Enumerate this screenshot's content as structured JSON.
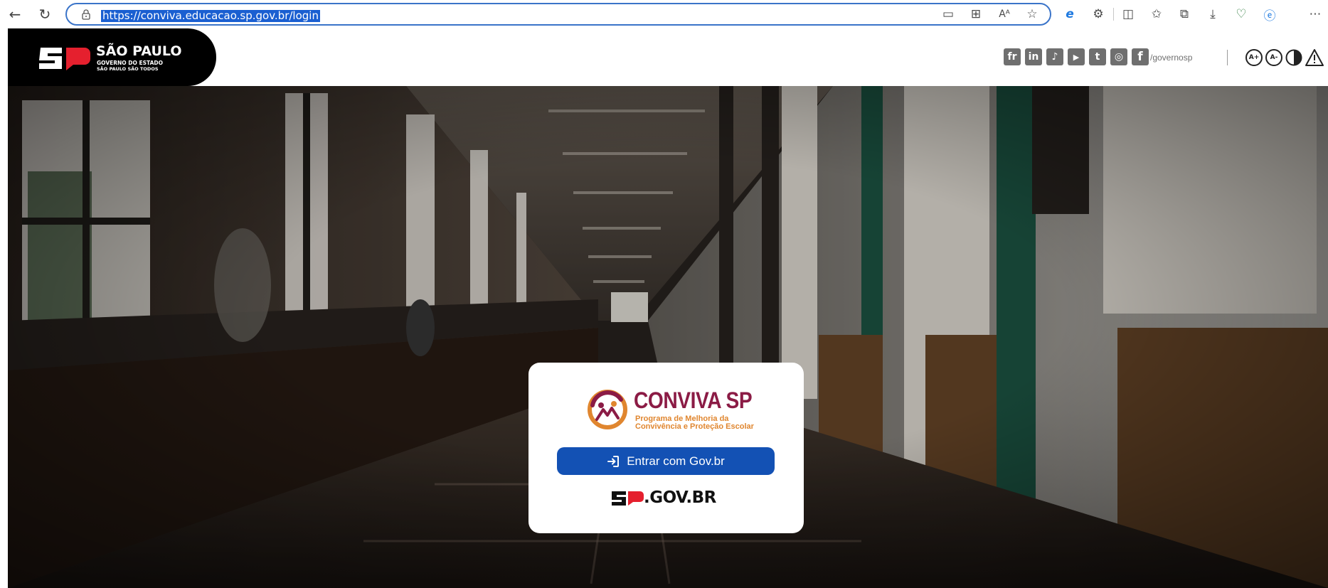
{
  "browser": {
    "url": "https://conviva.educacao.sp.gov.br/login",
    "toolbar_icons": [
      "back-icon",
      "reload-icon",
      "lock-icon",
      "device-icon",
      "qr-icon",
      "read-aloud-icon",
      "favorite-star-icon",
      "edge-icon",
      "extensions-icon",
      "split-screen-icon",
      "favorites-icon",
      "collections-icon",
      "download-icon",
      "health-icon",
      "edge-profile-icon",
      "more-icon"
    ]
  },
  "header": {
    "brand": {
      "title": "SÃO PAULO",
      "subtitle": "GOVERNO DO ESTADO",
      "tagline": "SÃO PAULO SÃO TODOS"
    },
    "social": {
      "icons": [
        {
          "name": "flickr-icon",
          "label": "fr"
        },
        {
          "name": "linkedin-icon",
          "label": "in"
        },
        {
          "name": "tiktok-icon",
          "label": "♪"
        },
        {
          "name": "youtube-icon",
          "label": "▶"
        },
        {
          "name": "twitter-icon",
          "label": "t"
        },
        {
          "name": "instagram-icon",
          "label": "◎"
        },
        {
          "name": "facebook-icon",
          "label": "f"
        }
      ],
      "handle": "/governosp"
    },
    "accessibility": {
      "increase_font": "A+",
      "decrease_font": "A-"
    }
  },
  "login": {
    "logo_title": "CONVIVA SP",
    "logo_subtitle_1": "Programa de Melhoria da",
    "logo_subtitle_2": "Convivência e Proteção Escolar",
    "button_label": "Entrar com Gov.br",
    "footer_logo_text": ".GOV.BR"
  },
  "colors": {
    "govbr_blue": "#1351b4",
    "conviva_wine": "#8b1b45",
    "conviva_orange": "#e0862f",
    "header_black": "#000000",
    "social_gray": "#6f6f6f",
    "address_blue": "#3a74c9"
  }
}
